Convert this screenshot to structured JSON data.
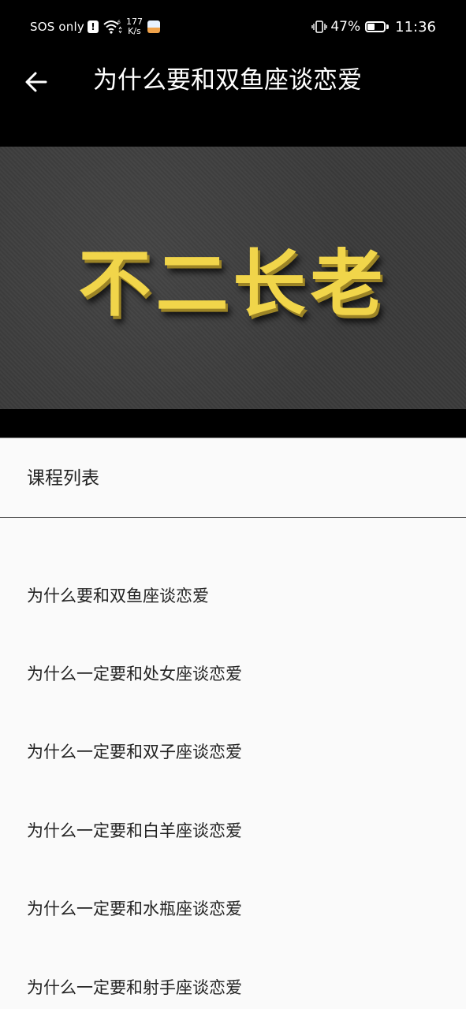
{
  "status_bar": {
    "carrier": "SOS only",
    "alert_glyph": "!",
    "network_speed_value": "177",
    "network_speed_unit": "K/s",
    "battery_percent": "47%",
    "battery_level": 0.47,
    "time": "11:36",
    "icons": [
      "alert-icon",
      "wifi-icon",
      "app-notification-icon",
      "vibrate-icon",
      "battery-icon"
    ]
  },
  "header": {
    "back_icon": "arrow-left-icon",
    "title": "为什么要和双鱼座谈恋爱"
  },
  "banner": {
    "text": "不二长老",
    "text_color": "#f1d54a",
    "background_color": "#3b3b3b"
  },
  "section": {
    "title": "课程列表"
  },
  "courses": [
    "为什么要和双鱼座谈恋爱",
    "为什么一定要和处女座谈恋爱",
    "为什么一定要和双子座谈恋爱",
    "为什么一定要和白羊座谈恋爱",
    "为什么一定要和水瓶座谈恋爱",
    "为什么一定要和射手座谈恋爱"
  ]
}
